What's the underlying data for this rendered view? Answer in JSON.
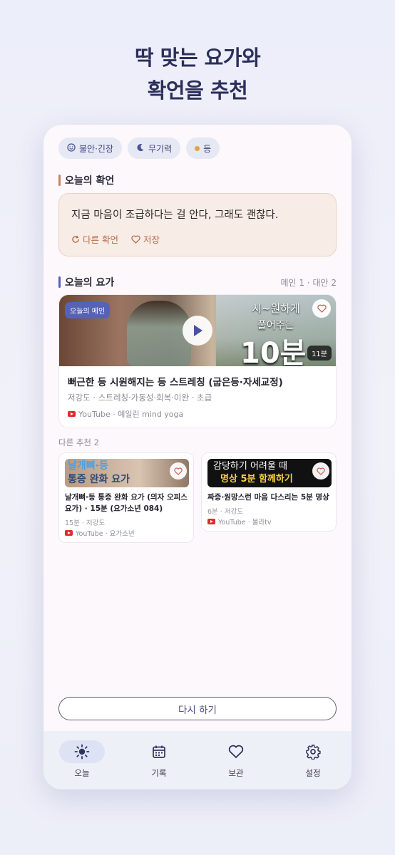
{
  "headline": {
    "line1": "딱 맞는 요가와",
    "line2": "확언을 추천"
  },
  "chips": [
    {
      "label": "불안·긴장",
      "icon": "smile-icon"
    },
    {
      "label": "무기력",
      "icon": "moon-icon"
    },
    {
      "label": "등",
      "icon": "dot-icon"
    }
  ],
  "affirmation": {
    "section_title": "오늘의 확언",
    "text": "지금 마음이 조급하다는 걸 안다, 그래도 괜찮다.",
    "refresh_label": "다른 확언",
    "save_label": "저장"
  },
  "yoga": {
    "section_title": "오늘의 요가",
    "meta": "메인 1 · 대안 2",
    "main": {
      "badge": "오늘의 메인",
      "thumb_line1": "시~원하게",
      "thumb_line2": "풀어주는",
      "thumb_big": "10분",
      "duration": "11분",
      "title": "뻐근한 등 시원해지는 등 스트레칭 (굽은등·자세교정)",
      "tags": "저강도 · 스트레칭·가동성·회복·이완 · 초급",
      "source": "YouTube · 예일린 mind yoga"
    },
    "more_label": "다른 추천 2",
    "alternatives": [
      {
        "thumb_line1": "날개뼈·등",
        "thumb_line2": "통증 완화 요가",
        "title": "날개뼈·등 통증 완화 요가 (의자 오피스 요가) · 15분 (요가소년 084)",
        "meta": "15분 · 저강도",
        "source": "YouTube · 요가소년"
      },
      {
        "thumb_line1": "감당하기 어려울 때",
        "thumb_line2": "명상 5분 함께하기",
        "title": "짜증·원망스런 마음 다스리는 5분 명상",
        "meta": "6분 · 저강도",
        "source": "YouTube · 몰라tv"
      }
    ]
  },
  "retry_label": "다시 하기",
  "nav": [
    {
      "label": "오늘",
      "icon": "sun-icon",
      "active": true
    },
    {
      "label": "기록",
      "icon": "calendar-icon"
    },
    {
      "label": "보관",
      "icon": "heart-icon"
    },
    {
      "label": "설정",
      "icon": "gear-icon"
    }
  ],
  "colors": {
    "accent": "#5662b6",
    "affirm_bar": "#c8825f",
    "yoga_bar": "#5662b6"
  }
}
